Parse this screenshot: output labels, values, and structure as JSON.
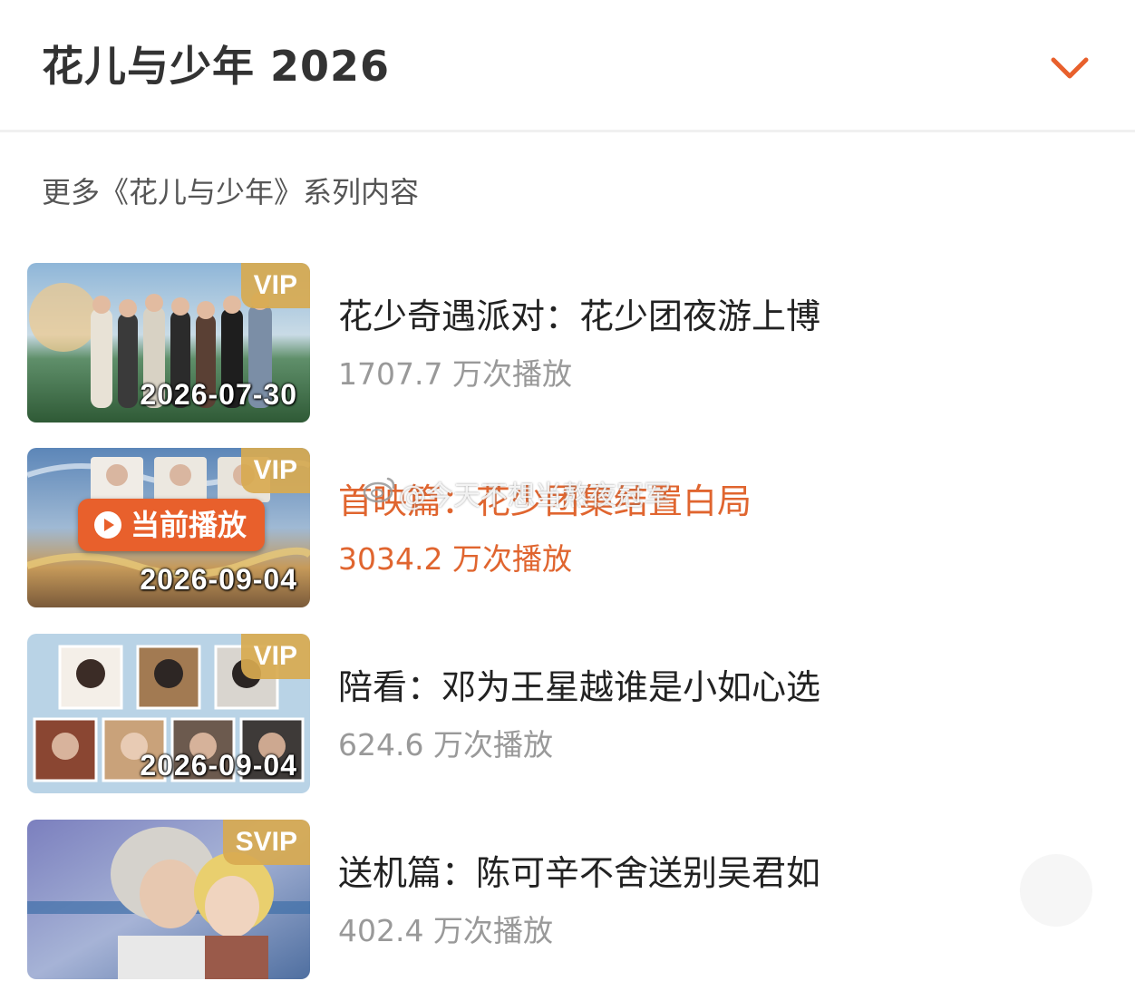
{
  "header": {
    "title": "花儿与少年 2026",
    "accent_color": "#e8602c"
  },
  "section": {
    "title": "更多《花儿与少年》系列内容"
  },
  "episodes": [
    {
      "badge": "VIP",
      "date": "2026-07-30",
      "title": "花少奇遇派对：花少团夜游上博",
      "views": "1707.7 万次播放",
      "active": false
    },
    {
      "badge": "VIP",
      "date": "2026-09-04",
      "title": "首映篇：花少团集结置白局",
      "views": "3034.2 万次播放",
      "active": true,
      "now_playing_label": "当前播放"
    },
    {
      "badge": "VIP",
      "date": "2026-09-04",
      "title": "陪看：邓为王星越谁是小如心选",
      "views": "624.6 万次播放",
      "active": false
    },
    {
      "badge": "SVIP",
      "date": "",
      "title": "送机篇：陈可辛不舍送别吴君如",
      "views": "402.4 万次播放",
      "active": false
    }
  ],
  "watermark": {
    "text": "@今天不想当熬夜冠军"
  },
  "icons": {
    "chevron": "chevron-down-icon",
    "play": "play-circle-icon",
    "watermark_logo": "weibo-logo-icon"
  }
}
